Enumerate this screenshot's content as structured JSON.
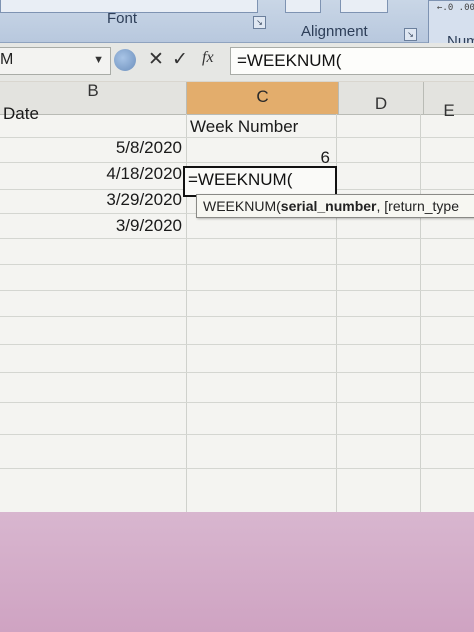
{
  "ribbon": {
    "groups": [
      "Font",
      "Alignment",
      "Num"
    ],
    "small_format_text": "←.0 .00"
  },
  "formula_bar": {
    "name_box": "M",
    "cancel_glyph": "✕",
    "enter_glyph": "✓",
    "fx_label": "fx",
    "formula": "=WEEKNUM("
  },
  "sheet": {
    "columns": [
      "B",
      "C",
      "D",
      "E"
    ],
    "active_column": "C",
    "header_row": {
      "b": "Date",
      "c": "Week Number"
    },
    "rows": [
      {
        "date": "5/8/2020",
        "week": "6"
      },
      {
        "date": "4/18/2020",
        "week": "=WEEKNUM("
      },
      {
        "date": "3/29/2020",
        "week": ""
      },
      {
        "date": "3/9/2020",
        "week": ""
      }
    ],
    "tooltip": {
      "func": "WEEKNUM(",
      "arg1": "serial_number",
      "rest": ", [return_type"
    }
  },
  "colors": {
    "active_header": "#e3ad6c",
    "grid": "#f4f4f1"
  }
}
